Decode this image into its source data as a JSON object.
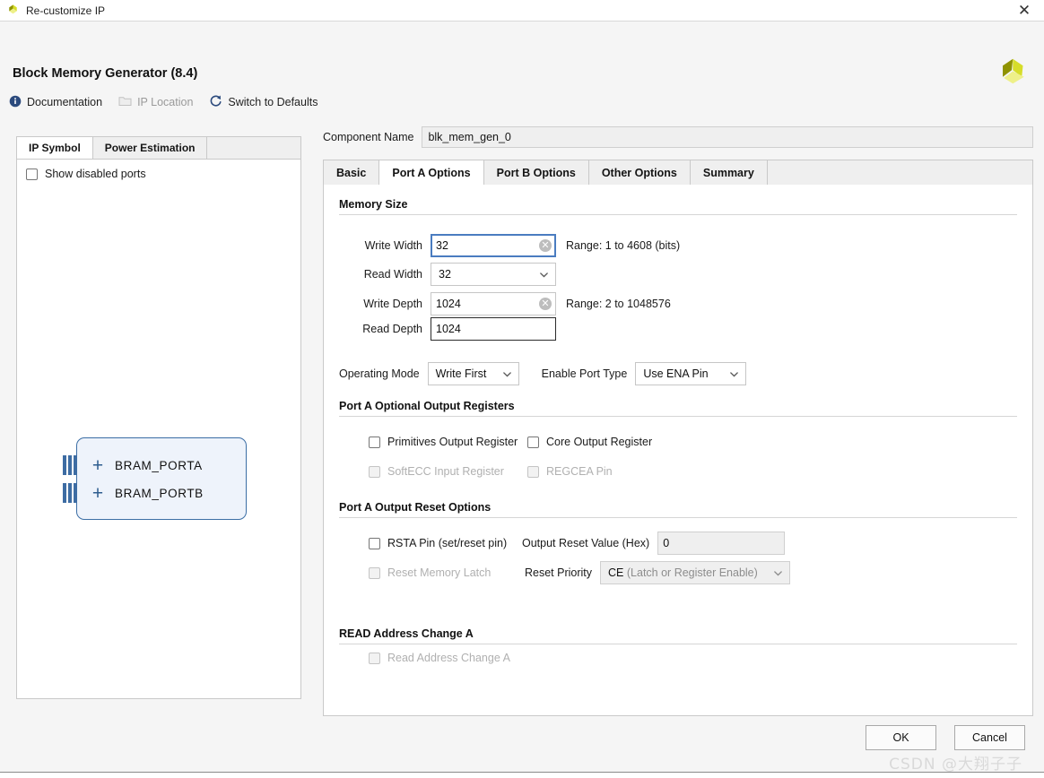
{
  "window": {
    "title": "Re-customize IP",
    "close_icon": "close-icon",
    "app_icon": "xilinx-logo-icon"
  },
  "header": {
    "app_title": "Block Memory Generator (8.4)",
    "brand_icon": "xilinx-pinwheel-logo"
  },
  "links": [
    {
      "label": "Documentation",
      "icon": "info-icon",
      "disabled": false
    },
    {
      "label": "IP Location",
      "icon": "folder-icon",
      "disabled": true
    },
    {
      "label": "Switch to Defaults",
      "icon": "refresh-icon",
      "disabled": false
    }
  ],
  "left_panel": {
    "tabs": [
      {
        "label": "IP Symbol",
        "active": true
      },
      {
        "label": "Power Estimation",
        "active": false
      }
    ],
    "show_disabled_ports": {
      "label": "Show disabled ports",
      "checked": false
    },
    "symbol": {
      "ports": [
        {
          "label": "BRAM_PORTA",
          "expander": "+"
        },
        {
          "label": "BRAM_PORTB",
          "expander": "+"
        }
      ]
    }
  },
  "component": {
    "label": "Component Name",
    "value": "blk_mem_gen_0"
  },
  "tabs": [
    {
      "label": "Basic",
      "active": false
    },
    {
      "label": "Port A Options",
      "active": true
    },
    {
      "label": "Port B Options",
      "active": false
    },
    {
      "label": "Other Options",
      "active": false
    },
    {
      "label": "Summary",
      "active": false
    }
  ],
  "memory_size": {
    "section_title": "Memory Size",
    "write_width": {
      "label": "Write Width",
      "value": "32",
      "range": "Range: 1 to 4608 (bits)",
      "focused": true,
      "clear_icon": "clear-icon"
    },
    "read_width": {
      "label": "Read Width",
      "value": "32",
      "caret_icon": "chevron-down-icon"
    },
    "write_depth": {
      "label": "Write Depth",
      "value": "1024",
      "range": "Range: 2 to 1048576",
      "clear_icon": "clear-icon"
    },
    "read_depth": {
      "label": "Read Depth",
      "value": "1024"
    }
  },
  "operating": {
    "mode_label": "Operating Mode",
    "mode_value": "Write First",
    "enable_port_label": "Enable Port Type",
    "enable_port_value": "Use ENA Pin"
  },
  "output_registers": {
    "section_title": "Port A Optional Output Registers",
    "items": [
      {
        "label": "Primitives Output Register",
        "checked": false,
        "disabled": false
      },
      {
        "label": "Core Output Register",
        "checked": false,
        "disabled": false
      },
      {
        "label": "SoftECC Input Register",
        "checked": false,
        "disabled": true
      },
      {
        "label": "REGCEA Pin",
        "checked": false,
        "disabled": true
      }
    ]
  },
  "reset_options": {
    "section_title": "Port A Output Reset Options",
    "rsta_pin": {
      "label": "RSTA Pin (set/reset pin)",
      "checked": false,
      "disabled": false
    },
    "reset_memory_latch": {
      "label": "Reset Memory Latch",
      "checked": false,
      "disabled": true
    },
    "output_reset_value": {
      "label": "Output Reset Value (Hex)",
      "value": "0"
    },
    "reset_priority": {
      "label": "Reset Priority",
      "value_strong": "CE",
      "value_muted": "(Latch or Register Enable)"
    }
  },
  "read_addr_change": {
    "section_title": "READ Address Change A",
    "item": {
      "label": "Read Address Change A",
      "checked": false,
      "disabled": true
    }
  },
  "footer": {
    "ok_label": "OK",
    "cancel_label": "Cancel"
  },
  "watermark": "CSDN @大翔子子",
  "colors": {
    "accent_blue": "#4a7cc0",
    "link_blue": "#2b4a7d",
    "symbol_border": "#3b6ea5",
    "symbol_fill": "#eef3fb",
    "brand_olive": "#a8ae1e"
  }
}
